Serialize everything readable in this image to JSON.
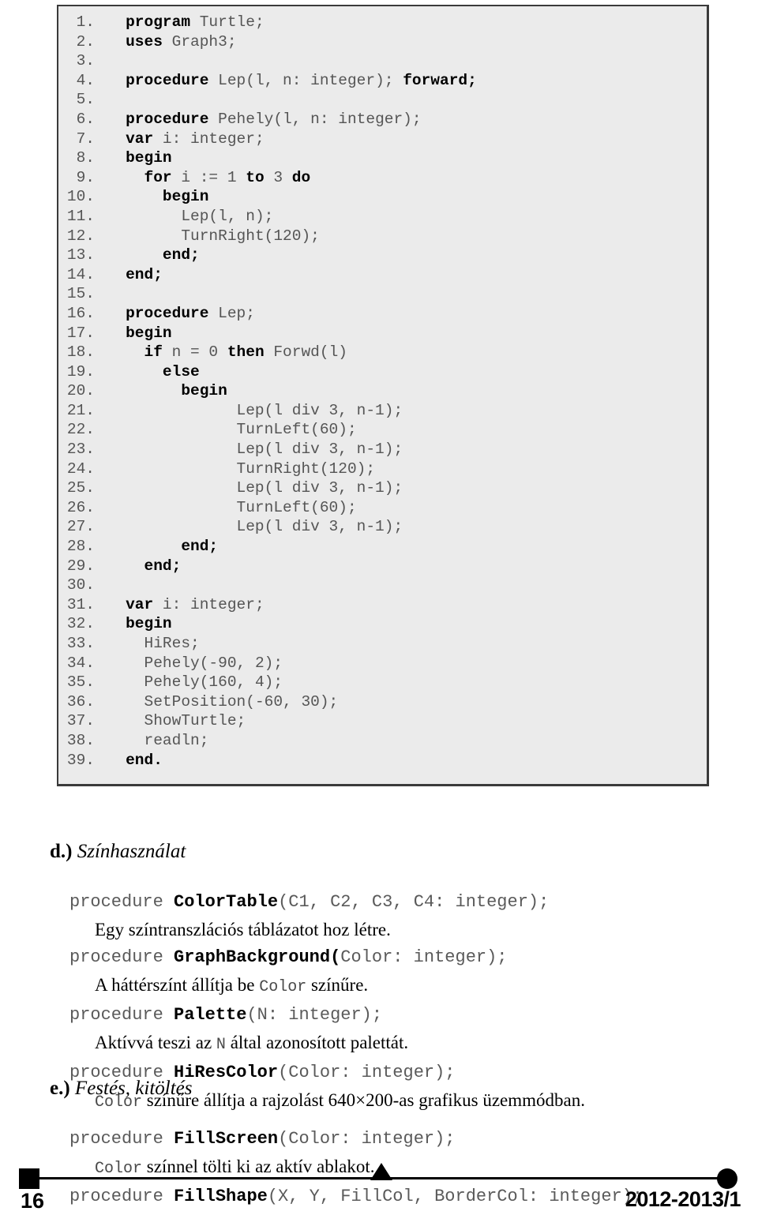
{
  "code_block": {
    "language": "pascal",
    "background": "#ebebeb",
    "border_color": "#3a3a3a",
    "lines": [
      {
        "n": "1.",
        "indent": 3,
        "parts": [
          {
            "t": "program ",
            "b": true
          },
          {
            "t": "Turtle;",
            "b": false
          }
        ]
      },
      {
        "n": "2.",
        "indent": 3,
        "parts": [
          {
            "t": "uses ",
            "b": true
          },
          {
            "t": "Graph3;",
            "b": false
          }
        ]
      },
      {
        "n": "3.",
        "indent": 3,
        "parts": []
      },
      {
        "n": "4.",
        "indent": 3,
        "parts": [
          {
            "t": "procedure ",
            "b": true
          },
          {
            "t": "Lep(l, n: integer); ",
            "b": false
          },
          {
            "t": "forward;",
            "b": true
          }
        ]
      },
      {
        "n": "5.",
        "indent": 3,
        "parts": []
      },
      {
        "n": "6.",
        "indent": 3,
        "parts": [
          {
            "t": "procedure ",
            "b": true
          },
          {
            "t": "Pehely(l, n: integer);",
            "b": false
          }
        ]
      },
      {
        "n": "7.",
        "indent": 3,
        "parts": [
          {
            "t": "var ",
            "b": true
          },
          {
            "t": "i: integer;",
            "b": false
          }
        ]
      },
      {
        "n": "8.",
        "indent": 3,
        "parts": [
          {
            "t": "begin",
            "b": true
          }
        ]
      },
      {
        "n": "9.",
        "indent": 5,
        "parts": [
          {
            "t": "for ",
            "b": true
          },
          {
            "t": "i := 1 ",
            "b": false
          },
          {
            "t": "to ",
            "b": true
          },
          {
            "t": "3 ",
            "b": false
          },
          {
            "t": "do",
            "b": true
          }
        ]
      },
      {
        "n": "10.",
        "indent": 7,
        "parts": [
          {
            "t": "begin",
            "b": true
          }
        ]
      },
      {
        "n": "11.",
        "indent": 9,
        "parts": [
          {
            "t": "Lep(l, n);",
            "b": false
          }
        ]
      },
      {
        "n": "12.",
        "indent": 9,
        "parts": [
          {
            "t": "TurnRight(120);",
            "b": false
          }
        ]
      },
      {
        "n": "13.",
        "indent": 7,
        "parts": [
          {
            "t": "end;",
            "b": true
          }
        ]
      },
      {
        "n": "14.",
        "indent": 3,
        "parts": [
          {
            "t": "end;",
            "b": true
          }
        ]
      },
      {
        "n": "15.",
        "indent": 3,
        "parts": []
      },
      {
        "n": "16.",
        "indent": 3,
        "parts": [
          {
            "t": "procedure ",
            "b": true
          },
          {
            "t": "Lep;",
            "b": false
          }
        ]
      },
      {
        "n": "17.",
        "indent": 3,
        "parts": [
          {
            "t": "begin",
            "b": true
          }
        ]
      },
      {
        "n": "18.",
        "indent": 5,
        "parts": [
          {
            "t": "if ",
            "b": true
          },
          {
            "t": "n = 0 ",
            "b": false
          },
          {
            "t": "then ",
            "b": true
          },
          {
            "t": "Forwd(l)",
            "b": false
          }
        ]
      },
      {
        "n": "19.",
        "indent": 7,
        "parts": [
          {
            "t": "else",
            "b": true
          }
        ]
      },
      {
        "n": "20.",
        "indent": 9,
        "parts": [
          {
            "t": "begin",
            "b": true
          }
        ]
      },
      {
        "n": "21.",
        "indent": 15,
        "parts": [
          {
            "t": "Lep(l div 3, n-1);",
            "b": false
          }
        ]
      },
      {
        "n": "22.",
        "indent": 15,
        "parts": [
          {
            "t": "TurnLeft(60);",
            "b": false
          }
        ]
      },
      {
        "n": "23.",
        "indent": 15,
        "parts": [
          {
            "t": "Lep(l div 3, n-1);",
            "b": false
          }
        ]
      },
      {
        "n": "24.",
        "indent": 15,
        "parts": [
          {
            "t": "TurnRight(120);",
            "b": false
          }
        ]
      },
      {
        "n": "25.",
        "indent": 15,
        "parts": [
          {
            "t": "Lep(l div 3, n-1);",
            "b": false
          }
        ]
      },
      {
        "n": "26.",
        "indent": 15,
        "parts": [
          {
            "t": "TurnLeft(60);",
            "b": false
          }
        ]
      },
      {
        "n": "27.",
        "indent": 15,
        "parts": [
          {
            "t": "Lep(l div 3, n-1);",
            "b": false
          }
        ]
      },
      {
        "n": "28.",
        "indent": 9,
        "parts": [
          {
            "t": "end;",
            "b": true
          }
        ]
      },
      {
        "n": "29.",
        "indent": 5,
        "parts": [
          {
            "t": "end;",
            "b": true
          }
        ]
      },
      {
        "n": "30.",
        "indent": 3,
        "parts": []
      },
      {
        "n": "31.",
        "indent": 3,
        "parts": [
          {
            "t": "var ",
            "b": true
          },
          {
            "t": "i: integer;",
            "b": false
          }
        ]
      },
      {
        "n": "32.",
        "indent": 3,
        "parts": [
          {
            "t": "begin",
            "b": true
          }
        ]
      },
      {
        "n": "33.",
        "indent": 5,
        "parts": [
          {
            "t": "HiRes;",
            "b": false
          }
        ]
      },
      {
        "n": "34.",
        "indent": 5,
        "parts": [
          {
            "t": "Pehely(-90, 2);",
            "b": false
          }
        ]
      },
      {
        "n": "35.",
        "indent": 5,
        "parts": [
          {
            "t": "Pehely(160, 4);",
            "b": false
          }
        ]
      },
      {
        "n": "36.",
        "indent": 5,
        "parts": [
          {
            "t": "SetPosition(-60, 30);",
            "b": false
          }
        ]
      },
      {
        "n": "37.",
        "indent": 5,
        "parts": [
          {
            "t": "ShowTurtle;",
            "b": false
          }
        ]
      },
      {
        "n": "38.",
        "indent": 5,
        "parts": [
          {
            "t": "readln;",
            "b": false
          }
        ]
      },
      {
        "n": "39.",
        "indent": 3,
        "parts": [
          {
            "t": "end.",
            "b": true
          }
        ]
      }
    ]
  },
  "section_d": {
    "letter": "d.)",
    "title": "Színhasználat",
    "entries": [
      {
        "prototype_parts": [
          {
            "t": "procedure ",
            "b": false
          },
          {
            "t": "ColorTable",
            "b": true
          },
          {
            "t": "(C1, C2, C3, C4: integer);",
            "b": false
          }
        ],
        "description": "Egy színtranszlációs táblázatot hoz létre."
      },
      {
        "prototype_parts": [
          {
            "t": "procedure ",
            "b": false
          },
          {
            "t": "GraphBackground(",
            "b": true
          },
          {
            "t": "Color: integer);",
            "b": false
          }
        ],
        "description_parts": [
          {
            "t": "A háttérszínt állítja be ",
            "mono": false
          },
          {
            "t": "Color",
            "mono": true
          },
          {
            "t": " színűre.",
            "mono": false
          }
        ]
      },
      {
        "prototype_parts": [
          {
            "t": "procedure ",
            "b": false
          },
          {
            "t": "Palette",
            "b": true
          },
          {
            "t": "(N: integer);",
            "b": false
          }
        ],
        "description_parts": [
          {
            "t": "Aktívvá teszi az ",
            "mono": false
          },
          {
            "t": "N",
            "mono": true
          },
          {
            "t": " által azonosított palettát.",
            "mono": false
          }
        ]
      },
      {
        "prototype_parts": [
          {
            "t": "procedure ",
            "b": false
          },
          {
            "t": "HiResColor",
            "b": true
          },
          {
            "t": "(Color: integer);",
            "b": false
          }
        ],
        "description_parts": [
          {
            "t": "Color",
            "mono": true
          },
          {
            "t": " színűre állítja a rajzolást 640×200-as grafikus üzemmódban.",
            "mono": false
          }
        ]
      }
    ]
  },
  "section_e": {
    "letter": "e.)",
    "title": "Festés, kitöltés",
    "entries": [
      {
        "prototype_parts": [
          {
            "t": "procedure ",
            "b": false
          },
          {
            "t": "FillScreen",
            "b": true
          },
          {
            "t": "(Color: integer);",
            "b": false
          }
        ],
        "description_parts": [
          {
            "t": "Color",
            "mono": true
          },
          {
            "t": " színnel tölti ki az aktív ablakot.",
            "mono": false
          }
        ]
      },
      {
        "prototype_parts": [
          {
            "t": "procedure ",
            "b": false
          },
          {
            "t": "FillShape",
            "b": true
          },
          {
            "t": "(X, Y, FillCol, BorderCol: integer);",
            "b": false
          }
        ],
        "description_parts": []
      }
    ]
  },
  "footer": {
    "page_number": "16",
    "issue_label": "2012-2013/1",
    "square_marker": "square-marker",
    "circle_marker": "circle-marker",
    "triangle_marker": "triangle-up-marker"
  }
}
